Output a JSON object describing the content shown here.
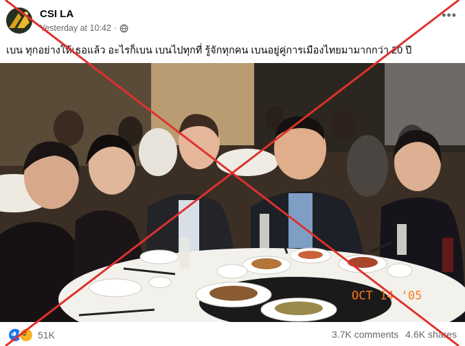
{
  "post": {
    "page_name": "CSI LA",
    "timestamp": "Yesterday at 10:42",
    "privacy_icon": "globe-icon",
    "more_icon": "more-options-icon",
    "caption": "เบน ทุกอย่างให้เธอแล้ว  อะไรก็เบน เบนไปทุกที่ รู้จักทุกคน เบนอยู่คู่การเมืองไทยมามากกว่า 20 ปี"
  },
  "photo": {
    "date_stamp": "OCT 14 '05"
  },
  "footer": {
    "reaction_count": "51K",
    "comments": "3.7K comments",
    "shares": "4.6K shares",
    "reaction_icons": [
      "like-icon",
      "haha-icon"
    ]
  },
  "overlay": {
    "cross_color": "#e0312d"
  }
}
